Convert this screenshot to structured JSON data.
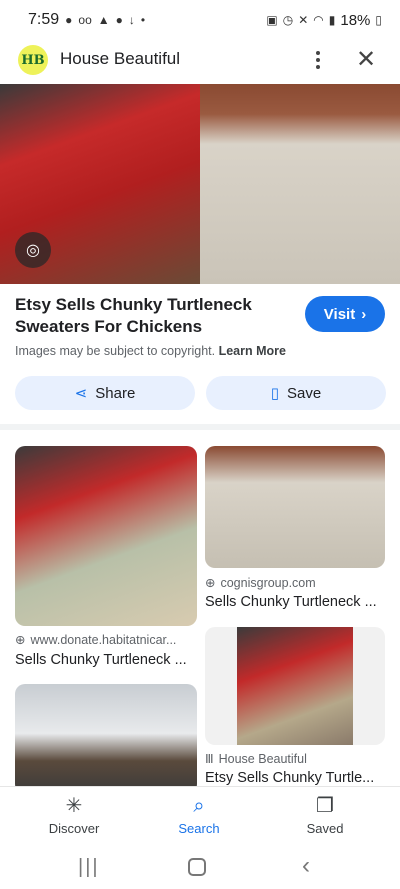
{
  "status_bar": {
    "time": "7:59",
    "battery": "18%"
  },
  "header": {
    "logo_text": "HB",
    "site_name": "House Beautiful"
  },
  "result": {
    "title": "Etsy Sells Chunky Turtleneck Sweaters For Chickens",
    "visit_label": "Visit",
    "copyright_text": "Images may be subject to copyright.",
    "learn_more": "Learn More",
    "share_label": "Share",
    "save_label": "Save"
  },
  "related": [
    {
      "source": "www.donate.habitatnicar...",
      "caption": "Sells Chunky Turtleneck ..."
    },
    {
      "source": "cognisgroup.com",
      "caption": "Sells Chunky Turtleneck ..."
    },
    {
      "source": "House Beautiful",
      "caption": "Etsy Sells Chunky Turtle..."
    }
  ],
  "bottom_nav": {
    "discover": "Discover",
    "search": "Search",
    "saved": "Saved"
  },
  "colors": {
    "accent": "#1a73e8",
    "pill_bg": "#e8f0fe"
  }
}
